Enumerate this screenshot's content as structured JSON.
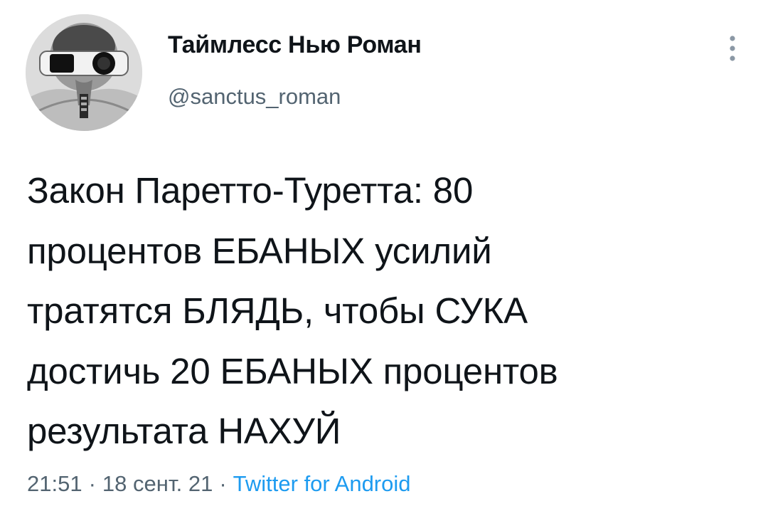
{
  "author": {
    "display_name": "Таймлесс Нью Роман",
    "handle": "@sanctus_roman",
    "avatar_icon": "retro-goggles-avatar"
  },
  "menu": {
    "icon": "more-vertical-icon"
  },
  "tweet": {
    "text": "Закон Паретто-Туретта: 80\nпроцентов ЕБАНЫХ усилий\nтратятся БЛЯДЬ, чтобы СУКА\nдостичь 20 ЕБАНЫХ процентов\nрезультата НАХУЙ"
  },
  "meta": {
    "time": "21:51",
    "separator": "·",
    "date": "18 сент. 21",
    "source": "Twitter for Android"
  },
  "colors": {
    "text_primary": "#0f1419",
    "text_secondary": "#536471",
    "link": "#1d9bf0",
    "background": "#ffffff"
  }
}
